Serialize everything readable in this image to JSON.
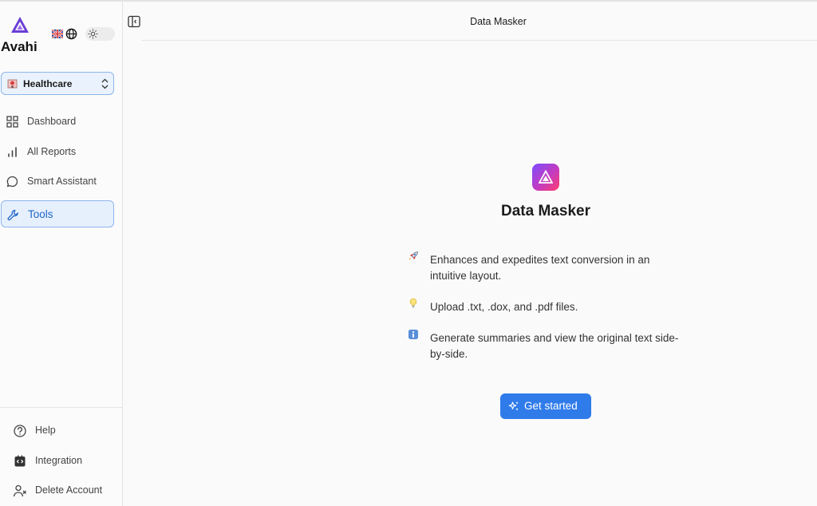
{
  "app": {
    "brand": "Avahi",
    "logo_icon": "avahi-triangle-logo",
    "accent": "#2f7bea"
  },
  "topbar": {
    "language_flag": "uk-flag-icon",
    "language_icon": "globe-icon",
    "theme_icon": "sun-icon"
  },
  "industry": {
    "label": "Healthcare",
    "icon": "hospital-icon"
  },
  "sidebar": {
    "items": [
      {
        "label": "Dashboard",
        "icon": "grid-icon"
      },
      {
        "label": "All Reports",
        "icon": "bar-chart-icon"
      },
      {
        "label": "Smart Assistant",
        "icon": "chat-bubble-icon"
      },
      {
        "label": "Tools",
        "icon": "wrench-icon",
        "active": true
      }
    ],
    "bottom": [
      {
        "label": "Help",
        "icon": "question-circle-icon"
      },
      {
        "label": "Integration",
        "icon": "code-icon"
      },
      {
        "label": "Delete Account",
        "icon": "user-remove-icon"
      }
    ]
  },
  "header": {
    "title": "Data Masker"
  },
  "main": {
    "title": "Data Masker",
    "features": [
      {
        "icon": "rocket-icon",
        "text": "Enhances and expedites text conversion in an intuitive layout."
      },
      {
        "icon": "lightbulb-icon",
        "text": "Upload .txt, .dox, and .pdf files."
      },
      {
        "icon": "info-icon",
        "text": "Generate summaries and view the original text side-by-side."
      }
    ],
    "cta_label": "Get started"
  }
}
